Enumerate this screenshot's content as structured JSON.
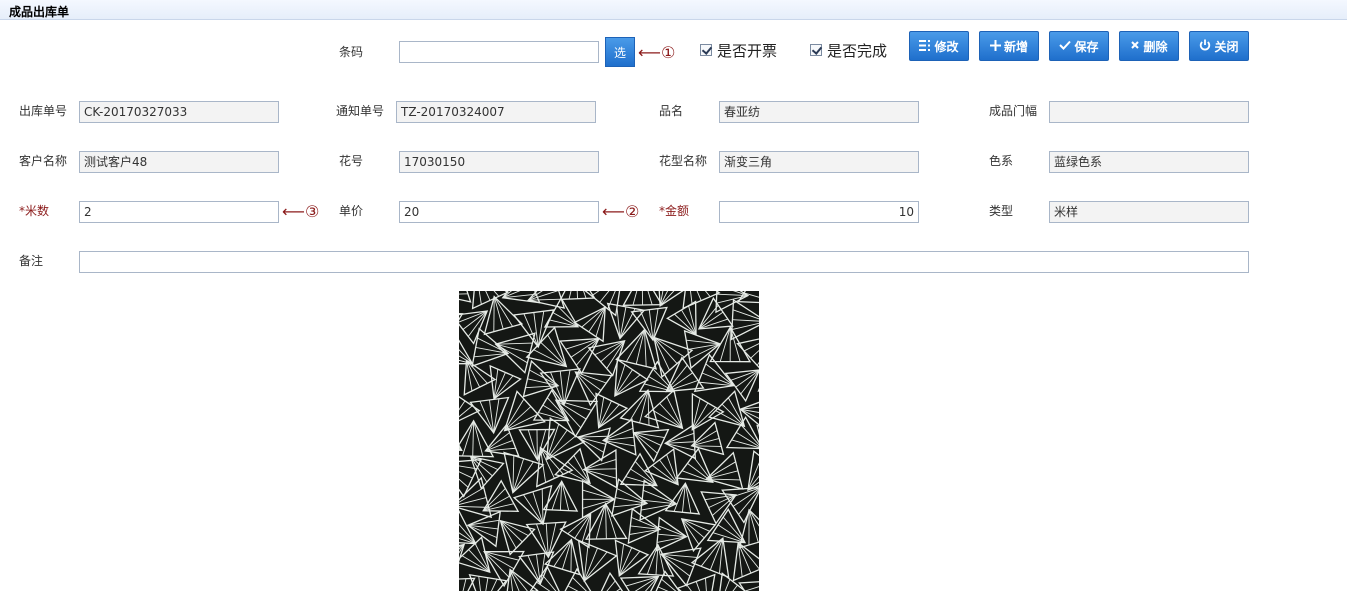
{
  "window": {
    "title": "成品出库单"
  },
  "toolbar": {
    "barcode_label": "条码",
    "barcode_value": "",
    "select_label": "选",
    "marker1": "⟵①",
    "invoiced_label": "是否开票",
    "completed_label": "是否完成",
    "edit_label": "修改",
    "new_label": "新增",
    "save_label": "保存",
    "delete_label": "删除",
    "close_label": "关闭"
  },
  "form": {
    "outbound_no": {
      "label": "出库单号",
      "value": "CK-20170327033"
    },
    "notice_no": {
      "label": "通知单号",
      "value": "TZ-20170324007"
    },
    "product_name": {
      "label": "品名",
      "value": "春亚纺"
    },
    "width": {
      "label": "成品门幅",
      "value": ""
    },
    "customer": {
      "label": "客户名称",
      "value": "测试客户48"
    },
    "pattern_no": {
      "label": "花号",
      "value": "17030150"
    },
    "pattern_name": {
      "label": "花型名称",
      "value": "渐变三角"
    },
    "color": {
      "label": "色系",
      "value": "蓝绿色系"
    },
    "meters": {
      "label": "*米数",
      "value": "2",
      "marker": "⟵③"
    },
    "unit_price": {
      "label": "单价",
      "value": "20",
      "marker": "⟵②"
    },
    "amount": {
      "label": "*金额",
      "value": "10"
    },
    "type": {
      "label": "类型",
      "value": "米样"
    },
    "remark": {
      "label": "备注",
      "value": ""
    }
  },
  "colors": {
    "button_top": "#4a9be9",
    "button_bottom": "#1f6fcc",
    "required_label": "#8b1a1a",
    "pattern_bg": "#141714",
    "pattern_line": "#e6ebe6"
  },
  "icons": {
    "edit": "list-icon",
    "new": "plus-icon",
    "save": "check-icon",
    "delete": "x-icon",
    "close": "power-icon"
  }
}
